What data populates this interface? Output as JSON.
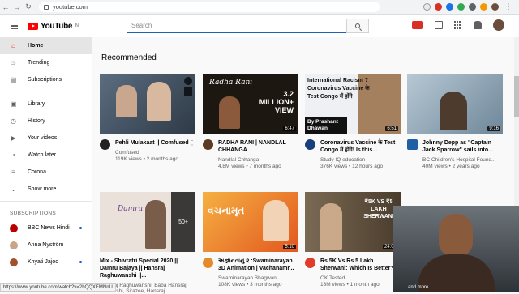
{
  "browser": {
    "url": "youtube.com",
    "status_url": "https://www.youtube.com/watch?v=2hQQXEMNnU"
  },
  "header": {
    "logo_text": "YouTube",
    "region": "IN",
    "search_placeholder": "Search"
  },
  "sidebar": {
    "primary": [
      {
        "label": "Home",
        "icon": "home-icon"
      },
      {
        "label": "Trending",
        "icon": "flame-icon"
      },
      {
        "label": "Subscriptions",
        "icon": "subscriptions-icon"
      }
    ],
    "library": [
      {
        "label": "Library",
        "icon": "library-icon"
      },
      {
        "label": "History",
        "icon": "history-icon"
      },
      {
        "label": "Your videos",
        "icon": "play-square-icon"
      },
      {
        "label": "Watch later",
        "icon": "clock-icon"
      },
      {
        "label": "Corona",
        "icon": "playlist-icon"
      },
      {
        "label": "Show more",
        "icon": "chevron-down-icon"
      }
    ],
    "subscriptions_heading": "SUBSCRIPTIONS",
    "subscriptions": [
      {
        "label": "BBC News Hindi",
        "color": "#b80000"
      },
      {
        "label": "Anna Nyström",
        "color": "#c9a38a"
      },
      {
        "label": "Khyati Jajoo",
        "color": "#a0522d"
      }
    ]
  },
  "main": {
    "section_title": "Recommended",
    "videos": [
      {
        "title": "Pehli Mulakaat || Comfused",
        "channel": "Comfused",
        "stats": "119K views • 2 months ago",
        "duration": "",
        "color": "#445566",
        "av": "#222"
      },
      {
        "title": "RADHA RANI | NANDLAL CHHANGA",
        "channel": "Nandlal Chhanga",
        "stats": "4.8M views • 7 months ago",
        "duration": "6:47",
        "color": "#2b2018",
        "av": "#5a3a22",
        "overlay": "Radha Rani",
        "big": "3.2 MILLION+ VIEW"
      },
      {
        "title": "Coronavirus Vaccine के Test Congo में होंगे! Is this...",
        "channel": "Study IQ education",
        "stats": "376K views • 12 hours ago",
        "duration": "6:51",
        "color": "#d9dde3",
        "av": "#1a3d7c",
        "overlay": "International Racism ? Coronavirus Vaccine के Test Congo में होंगे",
        "big": "By Prashant Dhawan"
      },
      {
        "title": "Johnny Depp as \"Captain Jack Sparrow\" sails into...",
        "channel": "BC Children's Hospital Found...",
        "stats": "40M views • 2 years ago",
        "duration": "9:16",
        "color": "#8fa7b8",
        "av": "#1f5fa5"
      },
      {
        "title": "Mix - Shivratri Special 2020 || Damru Bajaya || Hansraj Raghuwanshi ||...",
        "channel": "Hansraj Raghuwanshi, Baba Hansraj Ruwanshi, Sirazee, Hansraj...",
        "stats": "",
        "duration": "50+",
        "color": "#e8e0da",
        "av": "#7a5c4a",
        "overlay": "Damru"
      },
      {
        "title": "અજ્ઞાનતાનું ૨ :Swaminarayan 3D Animation | Vachanamr...",
        "channel": "Swaminarayan Bhagwan",
        "stats": "108K views • 3 months ago",
        "duration": "5:10",
        "color": "#f08a2a",
        "av": "#e38b2a",
        "overlay": "વચનામૃત"
      },
      {
        "title": "Rs 5K Vs Rs 5 Lakh Sherwani: Which Is Better?",
        "channel": "OK Tested",
        "stats": "13M views • 1 month ago",
        "duration": "24:06",
        "color": "#6a5a46",
        "av": "#e23b2b",
        "overlay": "₹5K VS ₹5 LAKH SHERWANI"
      },
      {
        "title": "",
        "channel": "",
        "stats": "",
        "duration": "",
        "color": "#333",
        "av": "#333"
      }
    ]
  },
  "webcam_caption": "and more"
}
